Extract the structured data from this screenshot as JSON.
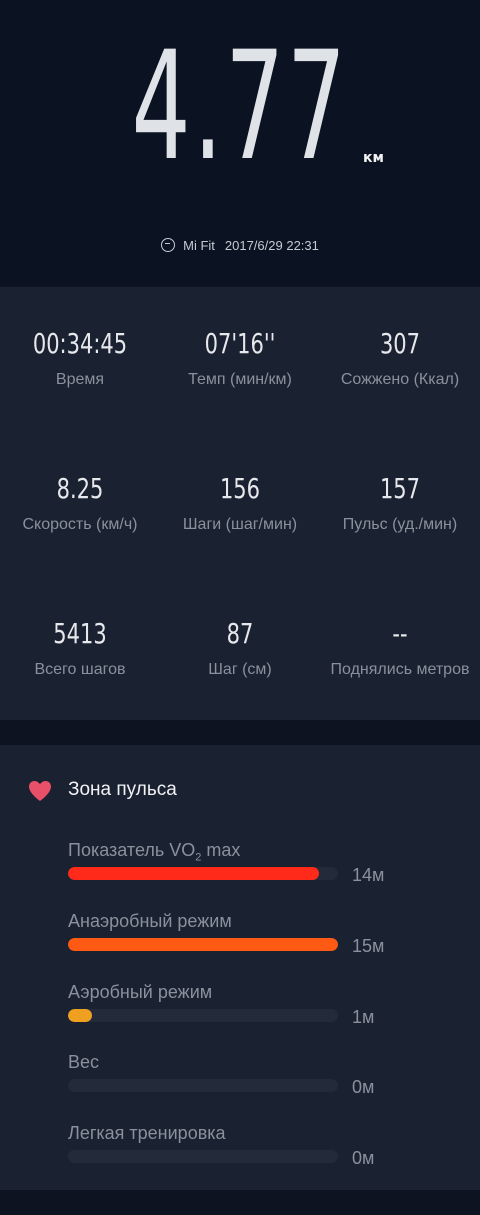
{
  "summary": {
    "distance": "4.77",
    "distance_unit": "км",
    "source": "Mi Fit",
    "datetime": "2017/6/29 22:31"
  },
  "stats": [
    {
      "value": "00:34:45",
      "label": "Время"
    },
    {
      "value": "07'16''",
      "label": "Темп (мин/км)"
    },
    {
      "value": "307",
      "label": "Сожжено (Ккал)"
    },
    {
      "value": "8.25",
      "label": "Скорость (км/ч)"
    },
    {
      "value": "156",
      "label": "Шаги (шаг/мин)"
    },
    {
      "value": "157",
      "label": "Пульс (уд./мин)"
    },
    {
      "value": "5413",
      "label": "Всего шагов"
    },
    {
      "value": "87",
      "label": "Шаг (см)"
    },
    {
      "value": "--",
      "label": "Поднялись метров"
    }
  ],
  "heart_zones": {
    "title": "Зона пульса",
    "zones": [
      {
        "name_prefix": "Показатель VO",
        "name_sub": "2",
        "name_suffix": " max",
        "time": "14м",
        "fraction": 0.93,
        "color": "#ff2a1a"
      },
      {
        "name_prefix": "Анаэробный режим",
        "name_sub": "",
        "name_suffix": "",
        "time": "15м",
        "fraction": 1.0,
        "color": "#ff5a14"
      },
      {
        "name_prefix": "Аэробный режим",
        "name_sub": "",
        "name_suffix": "",
        "time": "1м",
        "fraction": 0.09,
        "color": "#f0a020"
      },
      {
        "name_prefix": "Вес",
        "name_sub": "",
        "name_suffix": "",
        "time": "0м",
        "fraction": 0,
        "color": "#3a8ee6"
      },
      {
        "name_prefix": "Легкая тренировка",
        "name_sub": "",
        "name_suffix": "",
        "time": "0м",
        "fraction": 0,
        "color": "#888888"
      }
    ]
  },
  "colors": {
    "heart_icon": "#e8506a"
  }
}
